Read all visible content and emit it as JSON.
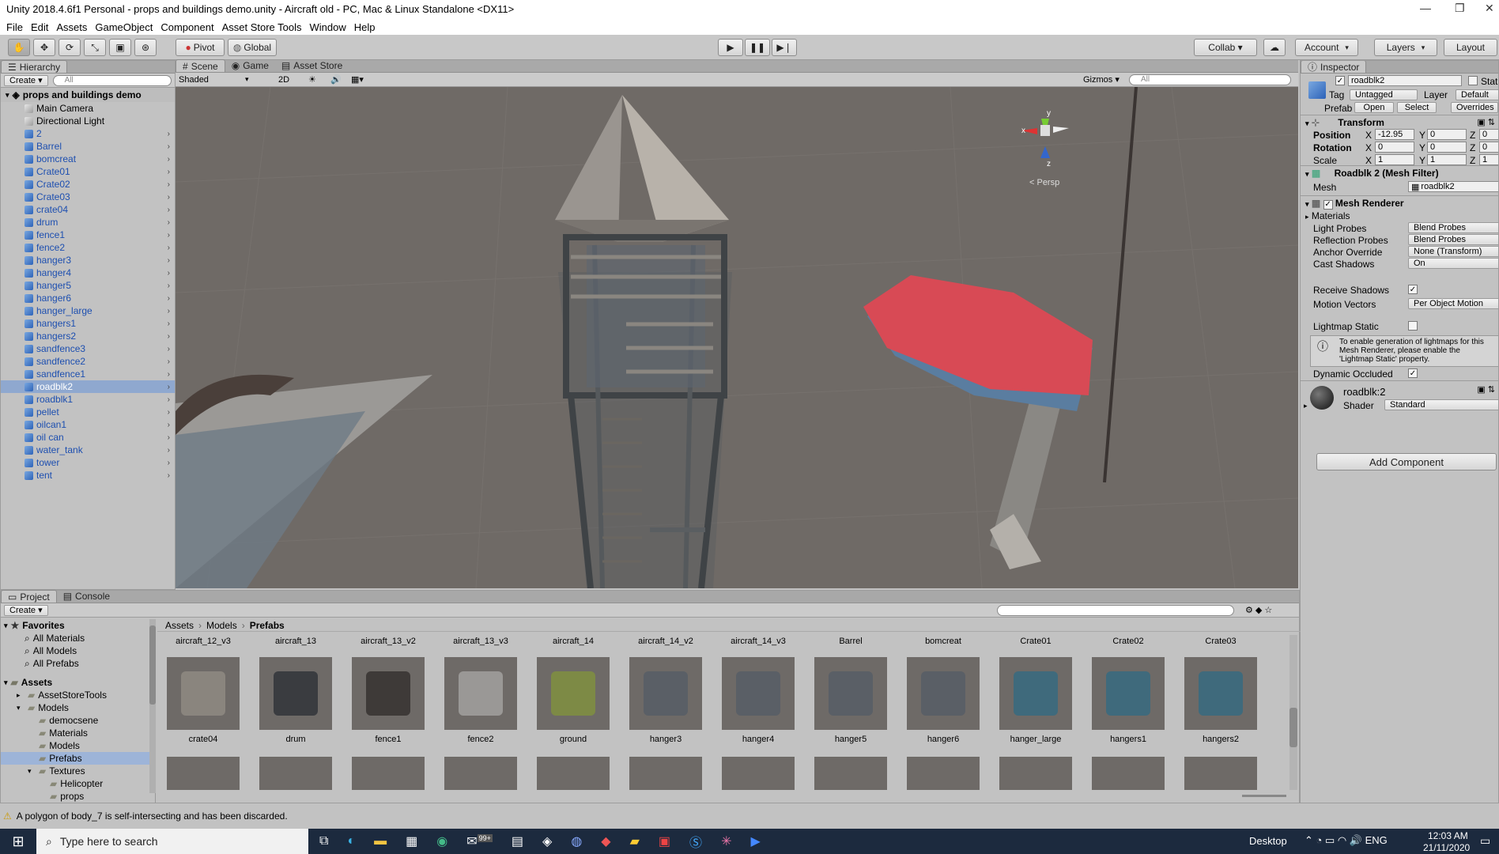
{
  "window": {
    "title": "Unity 2018.4.6f1 Personal - props and buildings demo.unity - Aircraft old - PC, Mac & Linux Standalone <DX11>"
  },
  "menu": [
    "File",
    "Edit",
    "Assets",
    "GameObject",
    "Component",
    "Asset Store Tools",
    "Window",
    "Help"
  ],
  "toolbar": {
    "pivot": "Pivot",
    "global": "Global",
    "collab": "Collab ▾",
    "account": "Account",
    "layers": "Layers",
    "layout": "Layout"
  },
  "hierarchy": {
    "tab": "Hierarchy",
    "create": "Create ▾",
    "search_placeholder": "All",
    "scene": "props and buildings demo",
    "items": [
      {
        "label": "Main Camera",
        "kind": "grey",
        "arrow": ""
      },
      {
        "label": "Directional Light",
        "kind": "grey",
        "arrow": ""
      },
      {
        "label": "2",
        "kind": "blue",
        "arrow": "›"
      },
      {
        "label": "Barrel",
        "kind": "blue",
        "arrow": "›"
      },
      {
        "label": "bomcreat",
        "kind": "blue",
        "arrow": "›"
      },
      {
        "label": "Crate01",
        "kind": "blue",
        "arrow": "›"
      },
      {
        "label": "Crate02",
        "kind": "blue",
        "arrow": "›"
      },
      {
        "label": "Crate03",
        "kind": "blue",
        "arrow": "›"
      },
      {
        "label": "crate04",
        "kind": "blue",
        "arrow": "›"
      },
      {
        "label": "drum",
        "kind": "blue",
        "arrow": "›"
      },
      {
        "label": "fence1",
        "kind": "blue",
        "arrow": "›"
      },
      {
        "label": "fence2",
        "kind": "blue",
        "arrow": "›"
      },
      {
        "label": "hanger3",
        "kind": "blue",
        "arrow": "›"
      },
      {
        "label": "hanger4",
        "kind": "blue",
        "arrow": "›"
      },
      {
        "label": "hanger5",
        "kind": "blue",
        "arrow": "›"
      },
      {
        "label": "hanger6",
        "kind": "blue",
        "arrow": "›"
      },
      {
        "label": "hanger_large",
        "kind": "blue",
        "arrow": "›"
      },
      {
        "label": "hangers1",
        "kind": "blue",
        "arrow": "›"
      },
      {
        "label": "hangers2",
        "kind": "blue",
        "arrow": "›"
      },
      {
        "label": "sandfence3",
        "kind": "blue",
        "arrow": "›"
      },
      {
        "label": "sandfence2",
        "kind": "blue",
        "arrow": "›"
      },
      {
        "label": "sandfence1",
        "kind": "blue",
        "arrow": "›"
      },
      {
        "label": "roadblk2",
        "kind": "blue",
        "arrow": "›",
        "selected": true
      },
      {
        "label": "roadblk1",
        "kind": "blue",
        "arrow": "›"
      },
      {
        "label": "pellet",
        "kind": "blue",
        "arrow": "›"
      },
      {
        "label": "oilcan1",
        "kind": "blue",
        "arrow": "›"
      },
      {
        "label": "oil can",
        "kind": "blue",
        "arrow": "›"
      },
      {
        "label": "water_tank",
        "kind": "blue",
        "arrow": "›"
      },
      {
        "label": "tower",
        "kind": "blue",
        "arrow": "›"
      },
      {
        "label": "tent",
        "kind": "blue",
        "arrow": "›"
      }
    ]
  },
  "scene": {
    "tabs": [
      "Scene",
      "Game",
      "Asset Store"
    ],
    "shading": "Shaded",
    "mode2d": "2D",
    "gizmos": "Gizmos ▾",
    "search_placeholder": "All",
    "persp": "< Persp",
    "axis_x": "x",
    "axis_y": "y",
    "axis_z": "z"
  },
  "inspector": {
    "tab": "Inspector",
    "object_name": "roadblk2",
    "static": "Static",
    "tag_label": "Tag",
    "tag_value": "Untagged",
    "layer_label": "Layer",
    "layer_value": "Default",
    "prefab_label": "Prefab",
    "open": "Open",
    "select": "Select",
    "overrides": "Overrides",
    "transform": "Transform",
    "position": "Position",
    "rotation": "Rotation",
    "scale": "Scale",
    "pos": {
      "x": "-12.95",
      "y": "0",
      "z": "0"
    },
    "rot": {
      "x": "0",
      "y": "0",
      "z": "0"
    },
    "scl": {
      "x": "1",
      "y": "1",
      "z": "1"
    },
    "X": "X",
    "Y": "Y",
    "Z": "Z",
    "meshfilter": "Roadblk 2 (Mesh Filter)",
    "mesh_label": "Mesh",
    "mesh_value": "roadblk2",
    "meshrenderer": "Mesh Renderer",
    "materials": "Materials",
    "props": [
      {
        "label": "Light Probes",
        "value": "Blend Probes"
      },
      {
        "label": "Reflection Probes",
        "value": "Blend Probes"
      },
      {
        "label": "Anchor Override",
        "value": "None (Transform)"
      },
      {
        "label": "Cast Shadows",
        "value": "On"
      }
    ],
    "receive_shadows": "Receive Shadows",
    "motion_vectors": "Motion Vectors",
    "motion_value": "Per Object Motion",
    "lightmap_static": "Lightmap Static",
    "help": "To enable generation of lightmaps for this Mesh Renderer, please enable the 'Lightmap Static' property.",
    "dynamic_occluded": "Dynamic Occluded",
    "material_name": "roadblk:2",
    "shader_label": "Shader",
    "shader_value": "Standard",
    "add_component": "Add Component"
  },
  "project": {
    "tabs": [
      "Project",
      "Console"
    ],
    "create": "Create ▾",
    "favorites": "Favorites",
    "fav_items": [
      "All Materials",
      "All Models",
      "All Prefabs"
    ],
    "assets": "Assets",
    "tree": [
      {
        "label": "AssetStoreTools",
        "indent": 1,
        "arrow": "▸"
      },
      {
        "label": "Models",
        "indent": 1,
        "arrow": "▾"
      },
      {
        "label": "democsene",
        "indent": 2,
        "arrow": ""
      },
      {
        "label": "Materials",
        "indent": 2,
        "arrow": ""
      },
      {
        "label": "Models",
        "indent": 2,
        "arrow": ""
      },
      {
        "label": "Prefabs",
        "indent": 2,
        "arrow": "",
        "selected": true
      },
      {
        "label": "Textures",
        "indent": 2,
        "arrow": "▾"
      },
      {
        "label": "Helicopter",
        "indent": 3,
        "arrow": ""
      },
      {
        "label": "props",
        "indent": 3,
        "arrow": ""
      }
    ],
    "breadcrumb": [
      "Assets",
      "Models",
      "Prefabs"
    ],
    "row0": [
      "aircraft_12_v3",
      "aircraft_13",
      "aircraft_13_v2",
      "aircraft_13_v3",
      "aircraft_14",
      "aircraft_14_v2",
      "aircraft_14_v3",
      "Barrel",
      "bomcreat",
      "Crate01",
      "Crate02",
      "Crate03"
    ],
    "row1": [
      "crate04",
      "drum",
      "fence1",
      "fence2",
      "ground",
      "hanger3",
      "hanger4",
      "hanger5",
      "hanger6",
      "hanger_large",
      "hangers1",
      "hangers2"
    ]
  },
  "status": {
    "message": "A polygon of body_7 is self-intersecting and has been discarded."
  },
  "taskbar": {
    "search": "Type here to search",
    "badge": "99+",
    "desktop": "Desktop",
    "time": "12:03 AM",
    "date": "21/11/2020"
  }
}
